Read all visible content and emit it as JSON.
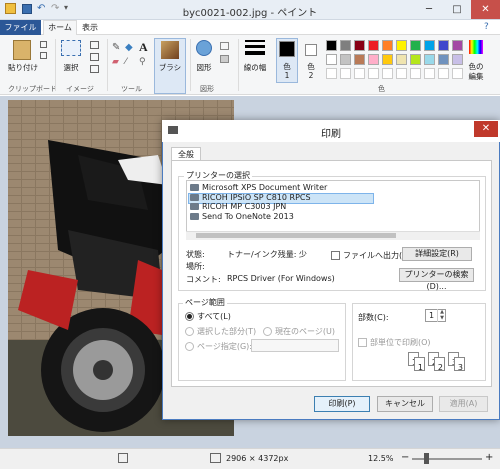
{
  "window": {
    "title": "byc0021-002.jpg - ペイント",
    "minimize": "─",
    "maximize": "□",
    "close": "✕"
  },
  "tabs": {
    "file": "ファイル",
    "home": "ホーム",
    "view": "表示"
  },
  "ribbon": {
    "paste": "貼り付け",
    "select": "選択",
    "brush": "ブラシ",
    "shapes": "図形",
    "line_width": "線の幅",
    "color1": "色\n1",
    "color1_a": "色",
    "color1_b": "1",
    "color2_a": "色",
    "color2_b": "2",
    "edit_colors_a": "色の",
    "edit_colors_b": "編集",
    "groups": {
      "clipboard": "クリップボード",
      "image": "イメージ",
      "tools": "ツール",
      "shapes": "図形",
      "colors": "色"
    },
    "palette": [
      "#000000",
      "#7f7f7f",
      "#880015",
      "#ed1c24",
      "#ff7f27",
      "#fff200",
      "#22b14c",
      "#00a2e8",
      "#3f48cc",
      "#a349a4",
      "#ffffff",
      "#c3c3c3",
      "#b97a57",
      "#ffaec9",
      "#ffc90e",
      "#efe4b0",
      "#b5e61d",
      "#99d9ea",
      "#7092be",
      "#c8bfe7"
    ]
  },
  "status": {
    "dimensions": "2906 × 4372px",
    "zoom": "12.5%",
    "minus": "−",
    "plus": "+"
  },
  "dialog": {
    "title": "印刷",
    "close": "✕",
    "tab_general": "全般",
    "printer_group": "プリンターの選択",
    "printers": [
      "Microsoft XPS Document Writer",
      "RICOH IPSiO SP C810 RPCS",
      "RICOH MP C3003 JPN",
      "Send To OneNote 2013"
    ],
    "status_label": "状態:",
    "status_value": "トナー/インク残量: 少",
    "location_label": "場所:",
    "comment_label": "コメント:",
    "comment_value": "RPCS Driver (For Windows)",
    "print_to_file": "ファイルへ出力(F)",
    "preferences": "詳細設定(R)",
    "find_printer": "プリンターの検索(D)...",
    "page_range": "ページ範囲",
    "all": "すべて(L)",
    "selection": "選択した部分(T)",
    "current_page": "現在のページ(U)",
    "pages": "ページ指定(G):",
    "copies_label": "部数(C):",
    "copies_value": "1",
    "collate": "部単位で印刷(O)",
    "collate_labels": [
      "1",
      "1",
      "2",
      "2",
      "3",
      "3"
    ],
    "print": "印刷(P)",
    "cancel": "キャンセル",
    "apply": "適用(A)"
  }
}
